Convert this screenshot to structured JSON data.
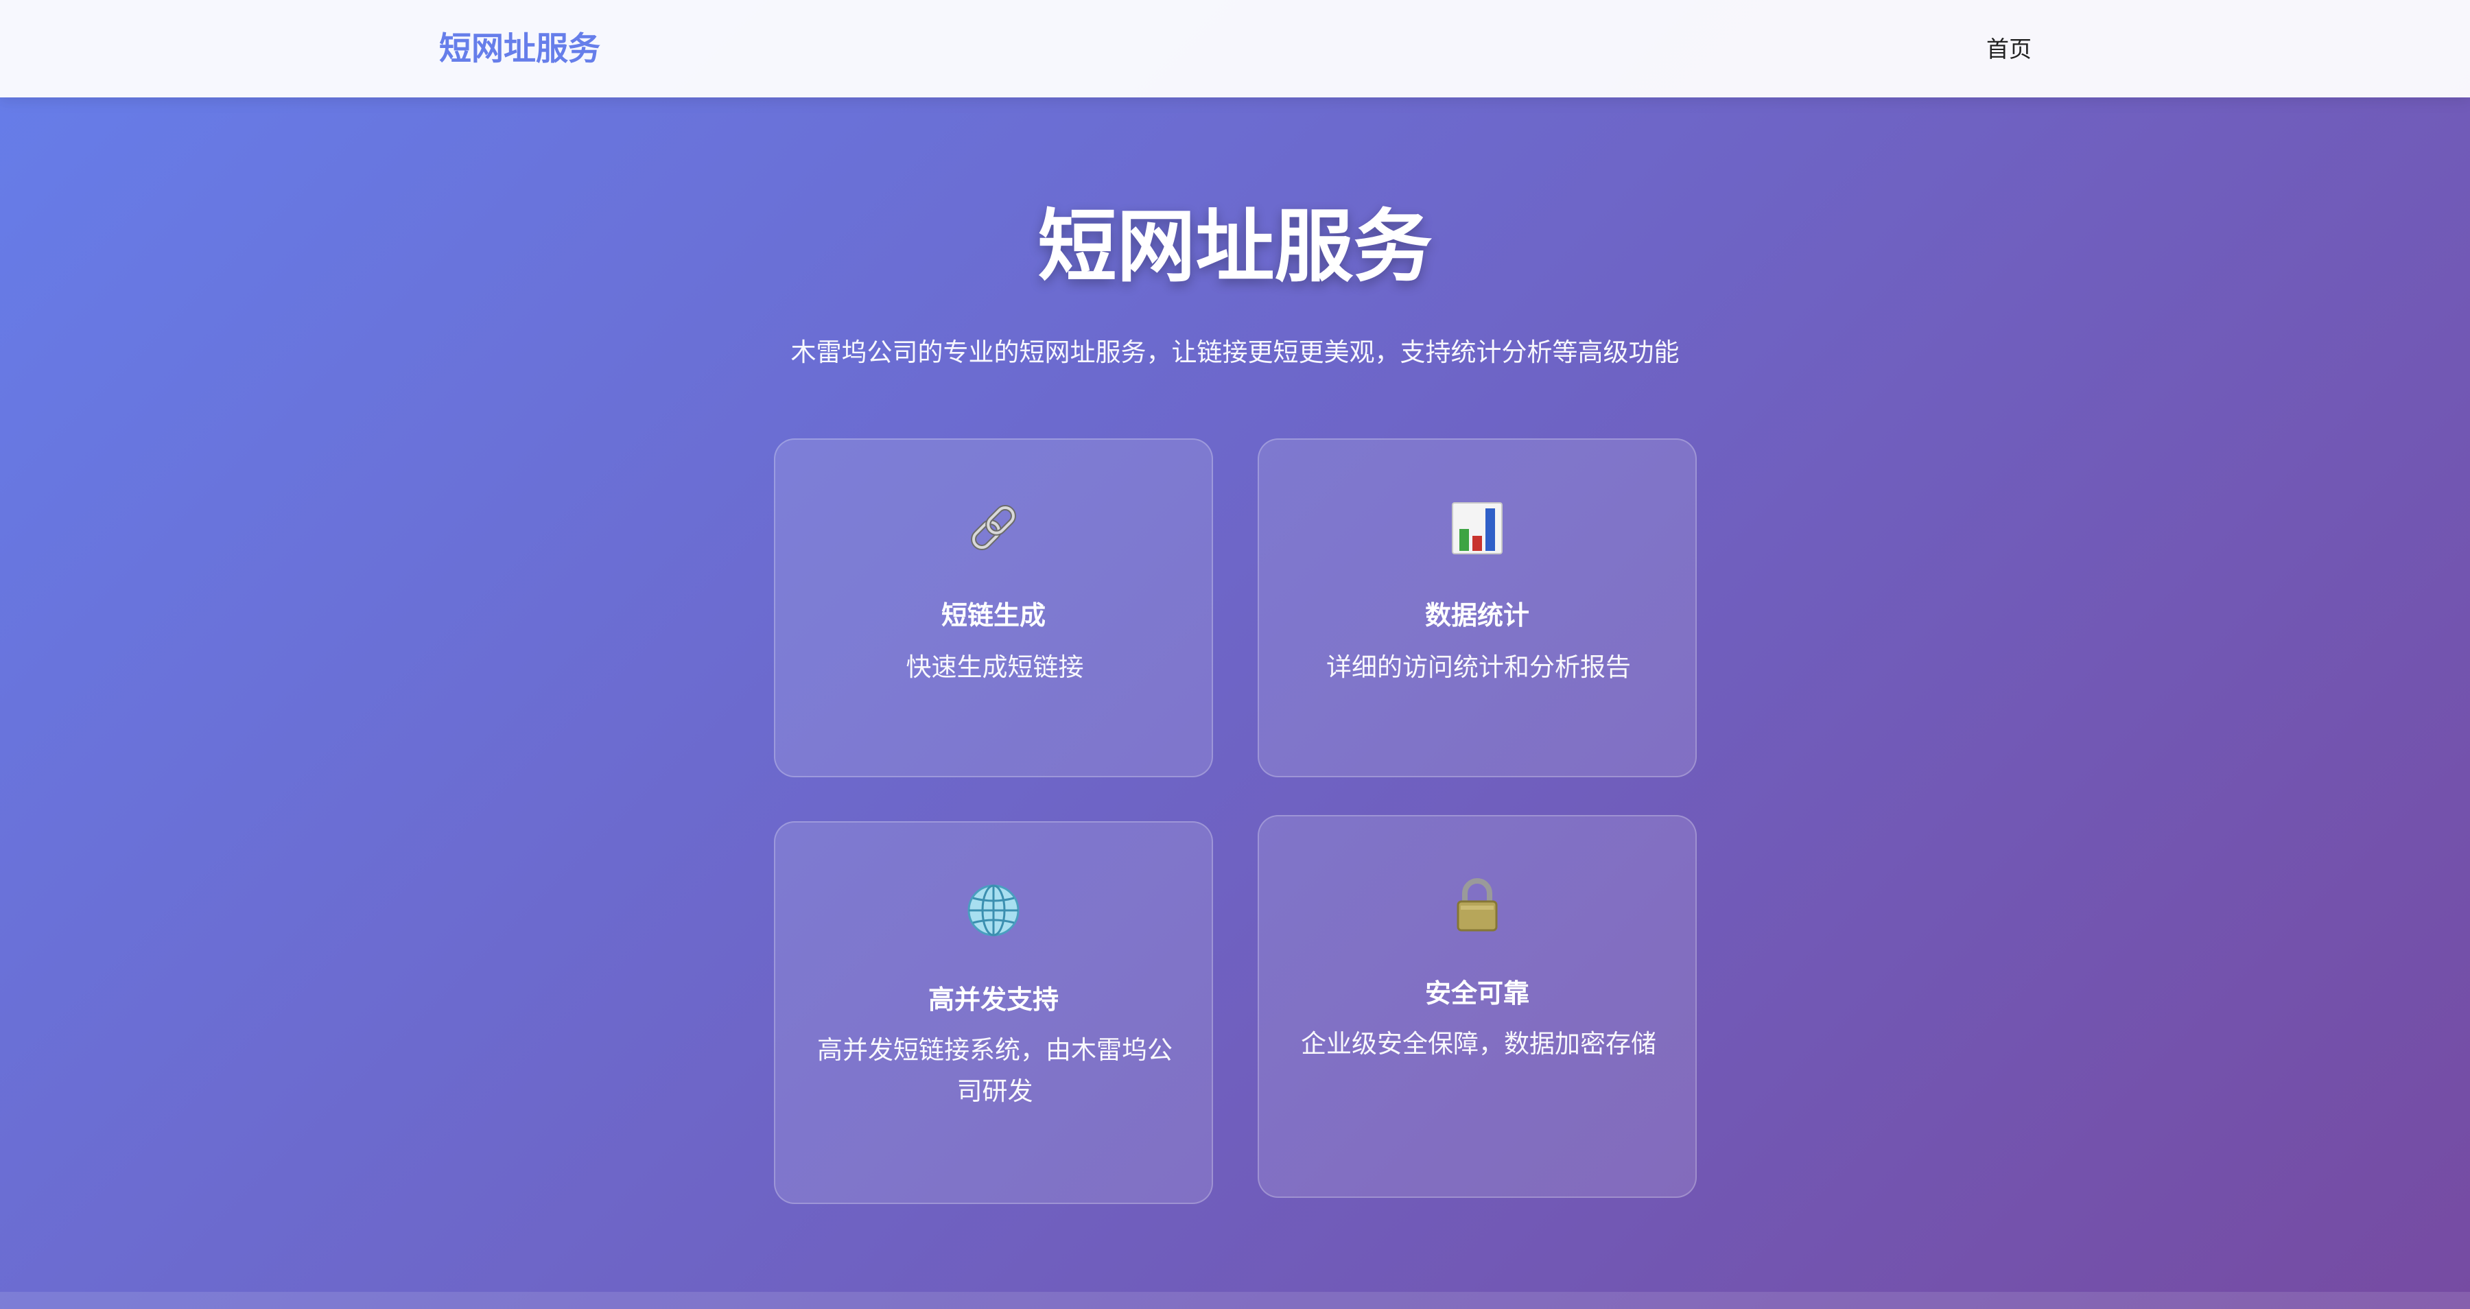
{
  "navbar": {
    "brand": "短网址服务",
    "links": [
      {
        "label": "首页"
      }
    ]
  },
  "hero": {
    "title": "短网址服务",
    "subtitle": "木雷坞公司的专业的短网址服务，让链接更短更美观，支持统计分析等高级功能"
  },
  "features": [
    {
      "icon": "link-icon",
      "title": "短链生成",
      "description": "快速生成短链接"
    },
    {
      "icon": "bar-chart-icon",
      "title": "数据统计",
      "description": "详细的访问统计和分析报告"
    },
    {
      "icon": "globe-icon",
      "title": "高并发支持",
      "description": "高并发短链接系统，由木雷坞公司研发"
    },
    {
      "icon": "lock-icon",
      "title": "安全可靠",
      "description": "企业级安全保障，数据加密存储"
    }
  ],
  "colors": {
    "brand": "#667eea",
    "gradient_start": "#667eea",
    "gradient_end": "#764ba2"
  }
}
